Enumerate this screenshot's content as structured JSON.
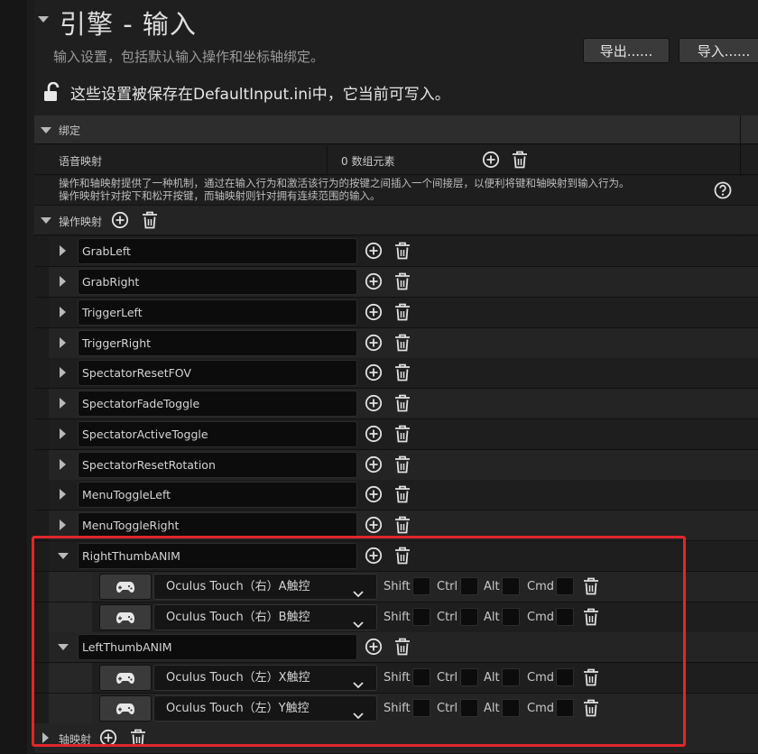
{
  "header": {
    "title": "引擎 - 输入",
    "subtitle": "输入设置，包括默认输入操作和坐标轴绑定。",
    "export_label": "导出......",
    "import_label": "导入......",
    "lock_text": "这些设置被保存在DefaultInput.ini中，它当前可写入。"
  },
  "bindings": {
    "section_label": "绑定",
    "speech_label": "语音映射",
    "speech_value": "0 数组元素",
    "description_line1": "操作和轴映射提供了一种机制，通过在输入行为和激活该行为的按键之间插入一个间接层，以便利将键和轴映射到输入行为。",
    "description_line2": "操作映射针对按下和松开按键，而轴映射则针对拥有连续范围的输入。",
    "action_label": "操作映射",
    "axis_label": "轴映射"
  },
  "actions": [
    {
      "name": "GrabLeft"
    },
    {
      "name": "GrabRight"
    },
    {
      "name": "TriggerLeft"
    },
    {
      "name": "TriggerRight"
    },
    {
      "name": "SpectatorResetFOV"
    },
    {
      "name": "SpectatorFadeToggle"
    },
    {
      "name": "SpectatorActiveToggle"
    },
    {
      "name": "SpectatorResetRotation"
    },
    {
      "name": "MenuToggleLeft"
    },
    {
      "name": "MenuToggleRight"
    },
    {
      "name": "RightThumbANIM"
    },
    {
      "name": "LeftThumbANIM"
    }
  ],
  "keys": [
    {
      "key": "Oculus Touch（右）A触控"
    },
    {
      "key": "Oculus Touch（右）B触控"
    },
    {
      "key": "Oculus Touch（左）X触控"
    },
    {
      "key": "Oculus Touch（左）Y触控"
    }
  ],
  "modifiers": {
    "shift": "Shift",
    "ctrl": "Ctrl",
    "alt": "Alt",
    "cmd": "Cmd"
  },
  "colors": {
    "highlight": "#e1262c",
    "background": "#1a1a1a"
  }
}
